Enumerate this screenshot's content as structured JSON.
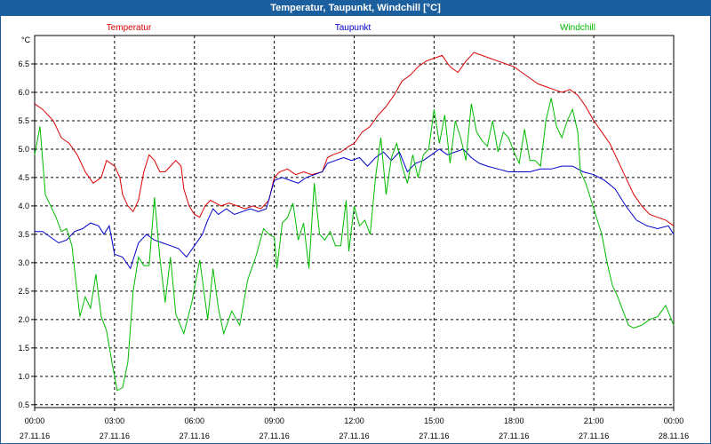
{
  "window": {
    "title": "Temperatur, Taupunkt, Windchill [°C]"
  },
  "chart_data": {
    "type": "line",
    "unit_label": "°C",
    "ylim": [
      0.45,
      7.0
    ],
    "y_ticks": [
      0.5,
      1.0,
      1.5,
      2.0,
      2.5,
      3.0,
      3.5,
      4.0,
      4.5,
      5.0,
      5.5,
      6.0,
      6.5
    ],
    "y_tick_labels": [
      "0.5",
      "1.0",
      "1.5",
      "2.0",
      "2.5",
      "3.0",
      "3.5",
      "4.0",
      "4.5",
      "5.0",
      "5.5",
      "6.0",
      "6.5"
    ],
    "x_ticks": [
      0,
      3,
      6,
      9,
      12,
      15,
      18,
      21,
      24
    ],
    "x_tick_labels": [
      {
        "time": "00:00",
        "date": "27.11.16"
      },
      {
        "time": "03:00",
        "date": "27.11.16"
      },
      {
        "time": "06:00",
        "date": "27.11.16"
      },
      {
        "time": "09:00",
        "date": "27.11.16"
      },
      {
        "time": "12:00",
        "date": "27.11.16"
      },
      {
        "time": "15:00",
        "date": "27.11.16"
      },
      {
        "time": "18:00",
        "date": "27.11.16"
      },
      {
        "time": "21:00",
        "date": "27.11.16"
      },
      {
        "time": "00:00",
        "date": "28.11.16"
      }
    ],
    "grid": true,
    "series": [
      {
        "name": "Temperatur",
        "color": "#dd0000",
        "legend_pos": "left",
        "points": [
          [
            0,
            5.8
          ],
          [
            0.3,
            5.7
          ],
          [
            0.7,
            5.5
          ],
          [
            1.0,
            5.2
          ],
          [
            1.3,
            5.1
          ],
          [
            1.6,
            4.9
          ],
          [
            1.9,
            4.6
          ],
          [
            2.2,
            4.4
          ],
          [
            2.5,
            4.5
          ],
          [
            2.7,
            4.8
          ],
          [
            3.0,
            4.7
          ],
          [
            3.2,
            4.5
          ],
          [
            3.3,
            4.2
          ],
          [
            3.5,
            4.0
          ],
          [
            3.7,
            3.9
          ],
          [
            3.9,
            4.1
          ],
          [
            4.1,
            4.6
          ],
          [
            4.3,
            4.9
          ],
          [
            4.5,
            4.8
          ],
          [
            4.7,
            4.6
          ],
          [
            4.9,
            4.6
          ],
          [
            5.1,
            4.7
          ],
          [
            5.3,
            4.8
          ],
          [
            5.5,
            4.7
          ],
          [
            5.6,
            4.3
          ],
          [
            5.8,
            4.0
          ],
          [
            6.0,
            3.85
          ],
          [
            6.2,
            3.8
          ],
          [
            6.4,
            4.0
          ],
          [
            6.6,
            4.1
          ],
          [
            6.8,
            4.05
          ],
          [
            7.0,
            4.0
          ],
          [
            7.3,
            4.05
          ],
          [
            7.6,
            4.0
          ],
          [
            7.9,
            3.95
          ],
          [
            8.2,
            4.0
          ],
          [
            8.5,
            3.95
          ],
          [
            8.8,
            4.1
          ],
          [
            9.0,
            4.5
          ],
          [
            9.2,
            4.6
          ],
          [
            9.5,
            4.65
          ],
          [
            9.8,
            4.55
          ],
          [
            10.1,
            4.6
          ],
          [
            10.4,
            4.55
          ],
          [
            10.8,
            4.6
          ],
          [
            11.0,
            4.85
          ],
          [
            11.2,
            4.9
          ],
          [
            11.5,
            4.95
          ],
          [
            11.8,
            5.05
          ],
          [
            12.0,
            5.1
          ],
          [
            12.3,
            5.3
          ],
          [
            12.6,
            5.4
          ],
          [
            12.9,
            5.6
          ],
          [
            13.2,
            5.75
          ],
          [
            13.5,
            5.95
          ],
          [
            13.8,
            6.2
          ],
          [
            14.1,
            6.3
          ],
          [
            14.4,
            6.45
          ],
          [
            14.7,
            6.55
          ],
          [
            15.0,
            6.6
          ],
          [
            15.3,
            6.65
          ],
          [
            15.6,
            6.45
          ],
          [
            15.9,
            6.35
          ],
          [
            16.2,
            6.55
          ],
          [
            16.5,
            6.7
          ],
          [
            16.8,
            6.65
          ],
          [
            17.1,
            6.6
          ],
          [
            17.4,
            6.55
          ],
          [
            17.7,
            6.5
          ],
          [
            18.0,
            6.45
          ],
          [
            18.3,
            6.35
          ],
          [
            18.6,
            6.25
          ],
          [
            18.9,
            6.15
          ],
          [
            19.2,
            6.1
          ],
          [
            19.5,
            6.05
          ],
          [
            19.8,
            6.0
          ],
          [
            20.1,
            6.05
          ],
          [
            20.4,
            5.95
          ],
          [
            20.7,
            5.75
          ],
          [
            21.0,
            5.5
          ],
          [
            21.3,
            5.3
          ],
          [
            21.6,
            5.1
          ],
          [
            21.9,
            4.8
          ],
          [
            22.2,
            4.5
          ],
          [
            22.5,
            4.2
          ],
          [
            22.8,
            4.0
          ],
          [
            23.1,
            3.85
          ],
          [
            23.4,
            3.8
          ],
          [
            23.7,
            3.75
          ],
          [
            24.0,
            3.65
          ]
        ]
      },
      {
        "name": "Taupunkt",
        "color": "#0000cc",
        "legend_pos": "center",
        "points": [
          [
            0,
            3.55
          ],
          [
            0.3,
            3.55
          ],
          [
            0.6,
            3.45
          ],
          [
            0.9,
            3.35
          ],
          [
            1.2,
            3.4
          ],
          [
            1.5,
            3.55
          ],
          [
            1.8,
            3.6
          ],
          [
            2.1,
            3.7
          ],
          [
            2.4,
            3.65
          ],
          [
            2.6,
            3.5
          ],
          [
            2.8,
            3.65
          ],
          [
            3.0,
            3.15
          ],
          [
            3.3,
            3.1
          ],
          [
            3.6,
            2.9
          ],
          [
            3.9,
            3.35
          ],
          [
            4.2,
            3.5
          ],
          [
            4.5,
            3.4
          ],
          [
            4.8,
            3.35
          ],
          [
            5.1,
            3.3
          ],
          [
            5.4,
            3.25
          ],
          [
            5.7,
            3.1
          ],
          [
            6.0,
            3.3
          ],
          [
            6.3,
            3.5
          ],
          [
            6.5,
            3.75
          ],
          [
            6.7,
            3.95
          ],
          [
            6.9,
            3.85
          ],
          [
            7.2,
            3.95
          ],
          [
            7.5,
            3.85
          ],
          [
            7.8,
            3.9
          ],
          [
            8.1,
            3.95
          ],
          [
            8.4,
            3.9
          ],
          [
            8.7,
            3.95
          ],
          [
            9.0,
            4.45
          ],
          [
            9.3,
            4.5
          ],
          [
            9.6,
            4.45
          ],
          [
            9.9,
            4.4
          ],
          [
            10.2,
            4.5
          ],
          [
            10.5,
            4.55
          ],
          [
            10.8,
            4.6
          ],
          [
            11.0,
            4.75
          ],
          [
            11.3,
            4.8
          ],
          [
            11.6,
            4.85
          ],
          [
            11.9,
            4.8
          ],
          [
            12.2,
            4.85
          ],
          [
            12.5,
            4.7
          ],
          [
            12.8,
            4.85
          ],
          [
            13.1,
            4.95
          ],
          [
            13.4,
            4.8
          ],
          [
            13.7,
            4.95
          ],
          [
            14.0,
            4.6
          ],
          [
            14.3,
            4.75
          ],
          [
            14.6,
            4.8
          ],
          [
            14.9,
            4.9
          ],
          [
            15.2,
            5.0
          ],
          [
            15.5,
            4.9
          ],
          [
            15.8,
            4.95
          ],
          [
            16.1,
            5.0
          ],
          [
            16.4,
            4.85
          ],
          [
            16.7,
            4.75
          ],
          [
            17.0,
            4.7
          ],
          [
            17.4,
            4.65
          ],
          [
            17.8,
            4.6
          ],
          [
            18.2,
            4.6
          ],
          [
            18.6,
            4.6
          ],
          [
            19.0,
            4.65
          ],
          [
            19.4,
            4.65
          ],
          [
            19.8,
            4.7
          ],
          [
            20.2,
            4.7
          ],
          [
            20.6,
            4.6
          ],
          [
            21.0,
            4.55
          ],
          [
            21.4,
            4.45
          ],
          [
            21.8,
            4.3
          ],
          [
            22.2,
            4.0
          ],
          [
            22.6,
            3.75
          ],
          [
            23.0,
            3.65
          ],
          [
            23.4,
            3.6
          ],
          [
            23.8,
            3.65
          ],
          [
            24.0,
            3.5
          ]
        ]
      },
      {
        "name": "Windchill",
        "color": "#00bb00",
        "legend_pos": "right",
        "points": [
          [
            0,
            4.9
          ],
          [
            0.2,
            5.4
          ],
          [
            0.4,
            4.2
          ],
          [
            0.6,
            4.0
          ],
          [
            0.8,
            3.8
          ],
          [
            1.0,
            3.55
          ],
          [
            1.2,
            3.6
          ],
          [
            1.4,
            3.3
          ],
          [
            1.7,
            2.05
          ],
          [
            1.9,
            2.4
          ],
          [
            2.1,
            2.2
          ],
          [
            2.3,
            2.8
          ],
          [
            2.5,
            2.05
          ],
          [
            2.7,
            1.8
          ],
          [
            2.9,
            1.25
          ],
          [
            3.1,
            0.75
          ],
          [
            3.3,
            0.8
          ],
          [
            3.5,
            1.25
          ],
          [
            3.7,
            2.5
          ],
          [
            3.9,
            3.1
          ],
          [
            4.1,
            2.95
          ],
          [
            4.3,
            2.95
          ],
          [
            4.5,
            4.15
          ],
          [
            4.7,
            3.1
          ],
          [
            4.9,
            2.3
          ],
          [
            5.1,
            3.1
          ],
          [
            5.3,
            2.1
          ],
          [
            5.6,
            1.75
          ],
          [
            5.9,
            2.3
          ],
          [
            6.2,
            3.05
          ],
          [
            6.5,
            2.0
          ],
          [
            6.7,
            2.9
          ],
          [
            6.9,
            2.2
          ],
          [
            7.1,
            1.75
          ],
          [
            7.4,
            2.15
          ],
          [
            7.7,
            1.9
          ],
          [
            8.0,
            2.7
          ],
          [
            8.3,
            3.1
          ],
          [
            8.6,
            3.6
          ],
          [
            8.8,
            3.5
          ],
          [
            9.0,
            3.45
          ],
          [
            9.1,
            2.9
          ],
          [
            9.3,
            3.7
          ],
          [
            9.5,
            3.8
          ],
          [
            9.7,
            4.05
          ],
          [
            9.9,
            3.4
          ],
          [
            10.1,
            3.7
          ],
          [
            10.3,
            2.9
          ],
          [
            10.5,
            4.4
          ],
          [
            10.7,
            3.5
          ],
          [
            10.9,
            3.4
          ],
          [
            11.1,
            3.55
          ],
          [
            11.3,
            3.3
          ],
          [
            11.5,
            3.3
          ],
          [
            11.7,
            4.1
          ],
          [
            11.8,
            3.2
          ],
          [
            12.0,
            4.0
          ],
          [
            12.2,
            3.65
          ],
          [
            12.4,
            3.75
          ],
          [
            12.6,
            3.5
          ],
          [
            12.8,
            4.5
          ],
          [
            13.0,
            5.2
          ],
          [
            13.2,
            4.2
          ],
          [
            13.4,
            4.85
          ],
          [
            13.6,
            5.1
          ],
          [
            13.8,
            4.7
          ],
          [
            14.0,
            4.4
          ],
          [
            14.2,
            4.9
          ],
          [
            14.4,
            4.5
          ],
          [
            14.6,
            4.9
          ],
          [
            14.8,
            5.0
          ],
          [
            15.0,
            5.7
          ],
          [
            15.2,
            5.1
          ],
          [
            15.4,
            5.6
          ],
          [
            15.6,
            4.75
          ],
          [
            15.8,
            5.5
          ],
          [
            16.0,
            5.2
          ],
          [
            16.2,
            4.8
          ],
          [
            16.4,
            5.8
          ],
          [
            16.6,
            5.3
          ],
          [
            16.8,
            5.15
          ],
          [
            17.0,
            5.05
          ],
          [
            17.2,
            5.5
          ],
          [
            17.4,
            4.95
          ],
          [
            17.6,
            5.3
          ],
          [
            17.8,
            5.2
          ],
          [
            18.0,
            4.95
          ],
          [
            18.2,
            4.75
          ],
          [
            18.4,
            5.35
          ],
          [
            18.6,
            4.8
          ],
          [
            18.8,
            4.8
          ],
          [
            19.0,
            4.7
          ],
          [
            19.2,
            5.5
          ],
          [
            19.4,
            5.9
          ],
          [
            19.6,
            5.4
          ],
          [
            19.8,
            5.2
          ],
          [
            20.0,
            5.5
          ],
          [
            20.2,
            5.7
          ],
          [
            20.4,
            5.3
          ],
          [
            20.5,
            4.6
          ],
          [
            20.7,
            4.4
          ],
          [
            20.9,
            4.1
          ],
          [
            21.1,
            3.8
          ],
          [
            21.3,
            3.5
          ],
          [
            21.5,
            3.0
          ],
          [
            21.7,
            2.6
          ],
          [
            21.9,
            2.4
          ],
          [
            22.1,
            2.15
          ],
          [
            22.3,
            1.9
          ],
          [
            22.5,
            1.85
          ],
          [
            22.8,
            1.9
          ],
          [
            23.1,
            2.0
          ],
          [
            23.4,
            2.05
          ],
          [
            23.7,
            2.25
          ],
          [
            24.0,
            1.9
          ]
        ]
      }
    ]
  }
}
